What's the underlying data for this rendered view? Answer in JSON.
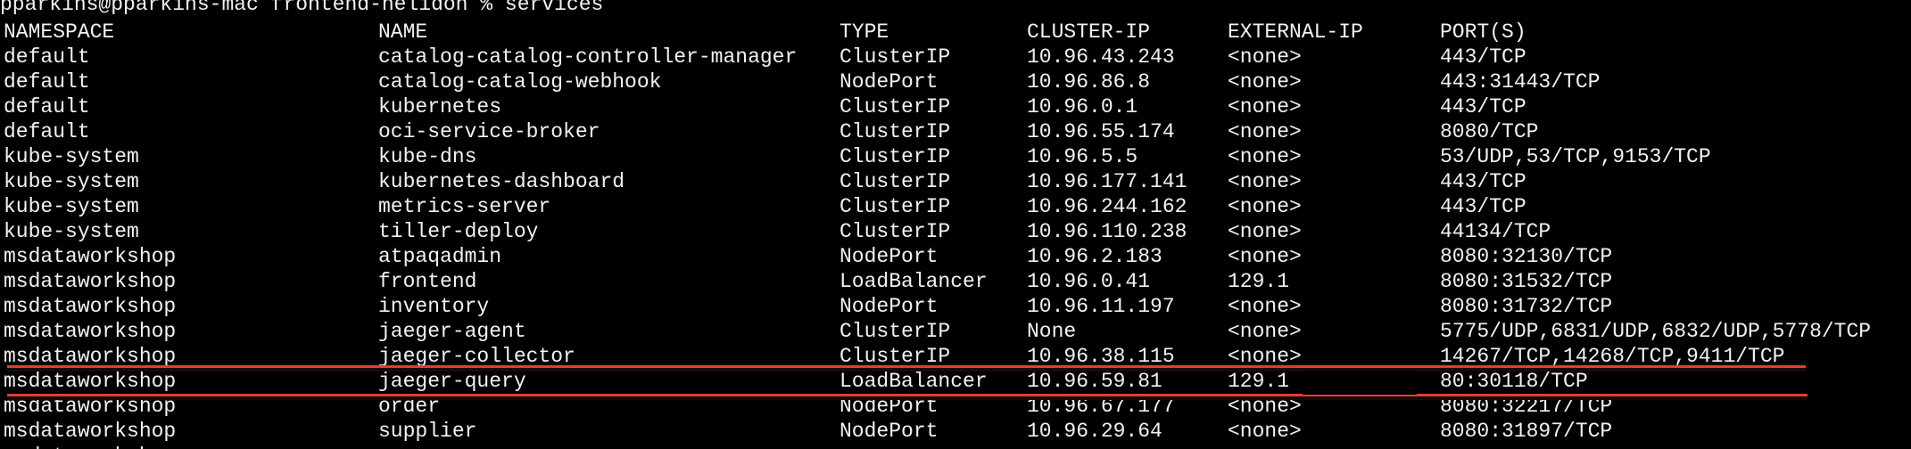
{
  "prompt": "pparkins@pparkins-mac frontend-helidon % services",
  "headers": [
    "NAMESPACE",
    "NAME",
    "TYPE",
    "CLUSTER-IP",
    "EXTERNAL-IP",
    "PORT(S)"
  ],
  "rows": [
    [
      "default",
      "catalog-catalog-controller-manager",
      "ClusterIP",
      "10.96.43.243",
      "<none>",
      "443/TCP"
    ],
    [
      "default",
      "catalog-catalog-webhook",
      "NodePort",
      "10.96.86.8",
      "<none>",
      "443:31443/TCP"
    ],
    [
      "default",
      "kubernetes",
      "ClusterIP",
      "10.96.0.1",
      "<none>",
      "443/TCP"
    ],
    [
      "default",
      "oci-service-broker",
      "ClusterIP",
      "10.96.55.174",
      "<none>",
      "8080/TCP"
    ],
    [
      "kube-system",
      "kube-dns",
      "ClusterIP",
      "10.96.5.5",
      "<none>",
      "53/UDP,53/TCP,9153/TCP"
    ],
    [
      "kube-system",
      "kubernetes-dashboard",
      "ClusterIP",
      "10.96.177.141",
      "<none>",
      "443/TCP"
    ],
    [
      "kube-system",
      "metrics-server",
      "ClusterIP",
      "10.96.244.162",
      "<none>",
      "443/TCP"
    ],
    [
      "kube-system",
      "tiller-deploy",
      "ClusterIP",
      "10.96.110.238",
      "<none>",
      "44134/TCP"
    ],
    [
      "msdataworkshop",
      "atpaqadmin",
      "NodePort",
      "10.96.2.183",
      "<none>",
      "8080:32130/TCP"
    ],
    [
      "msdataworkshop",
      "frontend",
      "LoadBalancer",
      "10.96.0.41",
      "129.1",
      "8080:31532/TCP"
    ],
    [
      "msdataworkshop",
      "inventory",
      "NodePort",
      "10.96.11.197",
      "<none>",
      "8080:31732/TCP"
    ],
    [
      "msdataworkshop",
      "jaeger-agent",
      "ClusterIP",
      "None",
      "<none>",
      "5775/UDP,6831/UDP,6832/UDP,5778/TCP"
    ],
    [
      "msdataworkshop",
      "jaeger-collector",
      "ClusterIP",
      "10.96.38.115",
      "<none>",
      "14267/TCP,14268/TCP,9411/TCP"
    ],
    [
      "msdataworkshop",
      "jaeger-query",
      "LoadBalancer",
      "10.96.59.81",
      "129.1",
      "80:30118/TCP"
    ],
    [
      "msdataworkshop",
      "order",
      "NodePort",
      "10.96.67.177",
      "<none>",
      "8080:32217/TCP"
    ],
    [
      "msdataworkshop",
      "supplier",
      "NodePort",
      "10.96.29.64",
      "<none>",
      "8080:31897/TCP"
    ]
  ],
  "colors": {
    "background": "#000000",
    "text": "#f2f2f2",
    "highlight": "#e0402e"
  }
}
